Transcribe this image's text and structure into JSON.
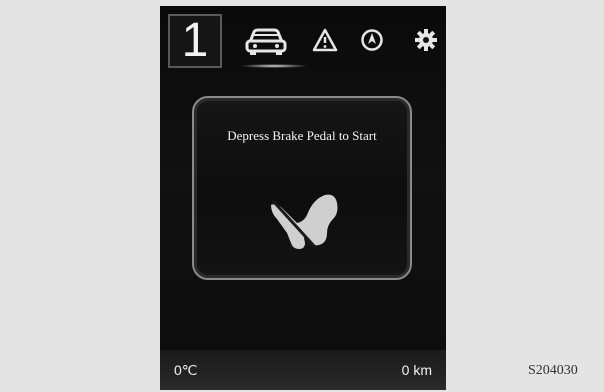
{
  "header": {
    "gear_number": "1",
    "tabs": [
      {
        "icon": "car-icon",
        "selected": true
      },
      {
        "icon": "warning-triangle-icon",
        "selected": false
      },
      {
        "icon": "navigation-compass-icon",
        "selected": false
      },
      {
        "icon": "settings-gear-icon",
        "selected": false
      }
    ]
  },
  "message": {
    "text": "Depress Brake Pedal to Start",
    "icon": "brake-pedal-icon"
  },
  "status_bar": {
    "temperature": "0℃",
    "odometer": "0 km"
  },
  "figure_code": "S204030"
}
